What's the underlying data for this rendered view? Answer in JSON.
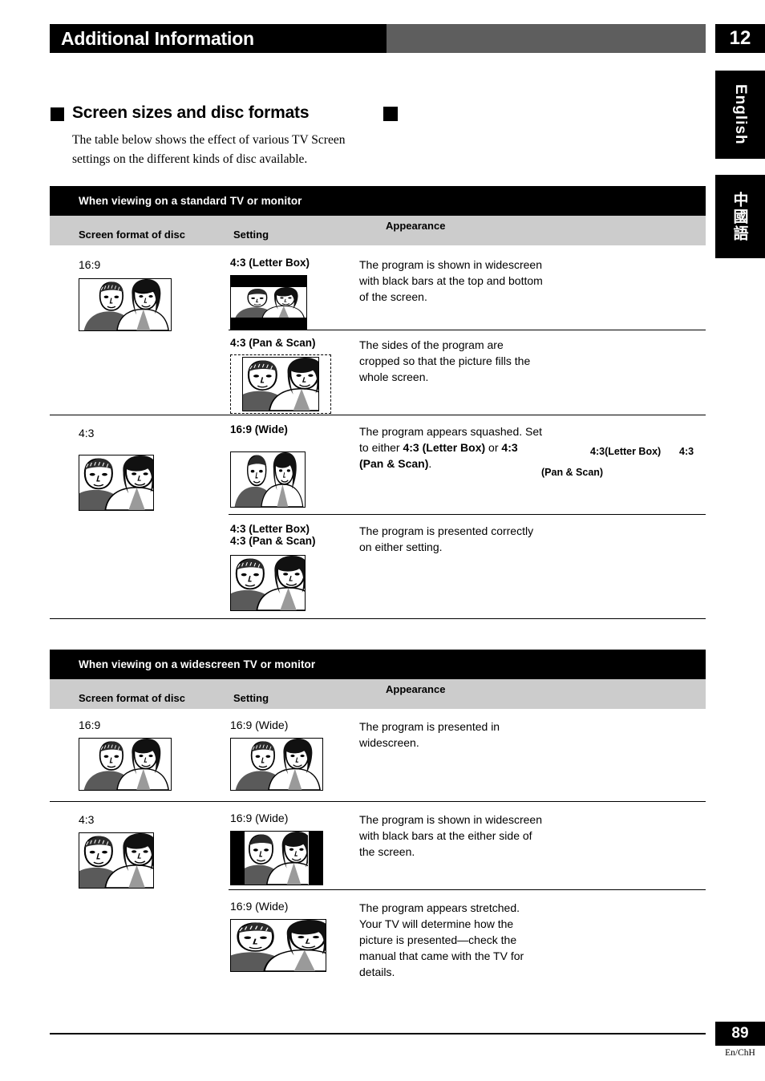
{
  "header": {
    "title": "Additional Information",
    "chapter": "12"
  },
  "side_tabs": [
    {
      "label": "English",
      "name": "tab-english"
    },
    {
      "label": "中國語",
      "name": "tab-chinese"
    }
  ],
  "section": {
    "title": "Screen sizes and disc formats",
    "body": "The table below shows the effect of various TV Screen settings on the different kinds of disc available."
  },
  "tables": [
    {
      "banner": "When viewing on a standard TV or monitor",
      "columns": {
        "disc": "Screen format of disc",
        "setting": "Setting",
        "appearance": "Appearance"
      },
      "rows": [
        {
          "disc_format": "16:9",
          "disc_pic": "16x9-widescreen",
          "settings": [
            {
              "setting": "4:3 (Letter Box)",
              "pic": "letterbox",
              "appearance": "The program is shown in widescreen with black bars at the top and bottom of the screen."
            },
            {
              "setting": "4:3 (Pan & Scan)",
              "pic": "panscan",
              "appearance": "The sides of the program are cropped so that the picture fills the whole screen."
            }
          ]
        },
        {
          "disc_format": "4:3",
          "disc_pic": "4x3-normal",
          "settings": [
            {
              "setting": "16:9 (Wide)",
              "pic": "squashed",
              "appearance_parts": [
                {
                  "text": "The program appears squashed. Set to either ",
                  "bold": false
                },
                {
                  "text": "4:3 (Letter Box)",
                  "bold": true
                },
                {
                  "text": " or ",
                  "bold": false
                },
                {
                  "text": "4:3 (Pan & Scan)",
                  "bold": true
                },
                {
                  "text": ".",
                  "bold": false
                }
              ],
              "orphan_text": [
                "4:3(Letter Box)",
                "4:3",
                "(Pan & Scan)"
              ]
            },
            {
              "setting": "4:3 (Letter Box)",
              "setting2": "4:3 (Pan & Scan)",
              "pic": "4x3-normal",
              "appearance": "The program is presented correctly on either setting."
            }
          ]
        }
      ]
    },
    {
      "banner": "When viewing on a widescreen TV or monitor",
      "columns": {
        "disc": "Screen format of disc",
        "setting": "Setting",
        "appearance": "Appearance"
      },
      "rows": [
        {
          "disc_format": "16:9",
          "disc_pic": "16x9-widescreen",
          "settings": [
            {
              "setting": "16:9 (Wide)",
              "pic": "16x9-widescreen",
              "appearance": "The program is presented in widescreen."
            }
          ]
        },
        {
          "disc_format": "4:3",
          "disc_pic": "4x3-normal",
          "settings": [
            {
              "setting": "16:9 (Wide)",
              "pic": "pillarbox",
              "appearance": "The program is shown in widescreen with black bars at the either side of the screen."
            },
            {
              "setting": "16:9 (Wide)",
              "pic": "stretched",
              "appearance": "The program appears stretched. Your TV will determine how the picture is presented—check the manual that came with the TV for details."
            }
          ]
        }
      ]
    }
  ],
  "footer": {
    "page": "89",
    "language_code": "En/ChH"
  },
  "colors": {
    "header_black": "#000000",
    "header_gray": "#5e5e5e",
    "column_header_gray": "#cccccc"
  }
}
